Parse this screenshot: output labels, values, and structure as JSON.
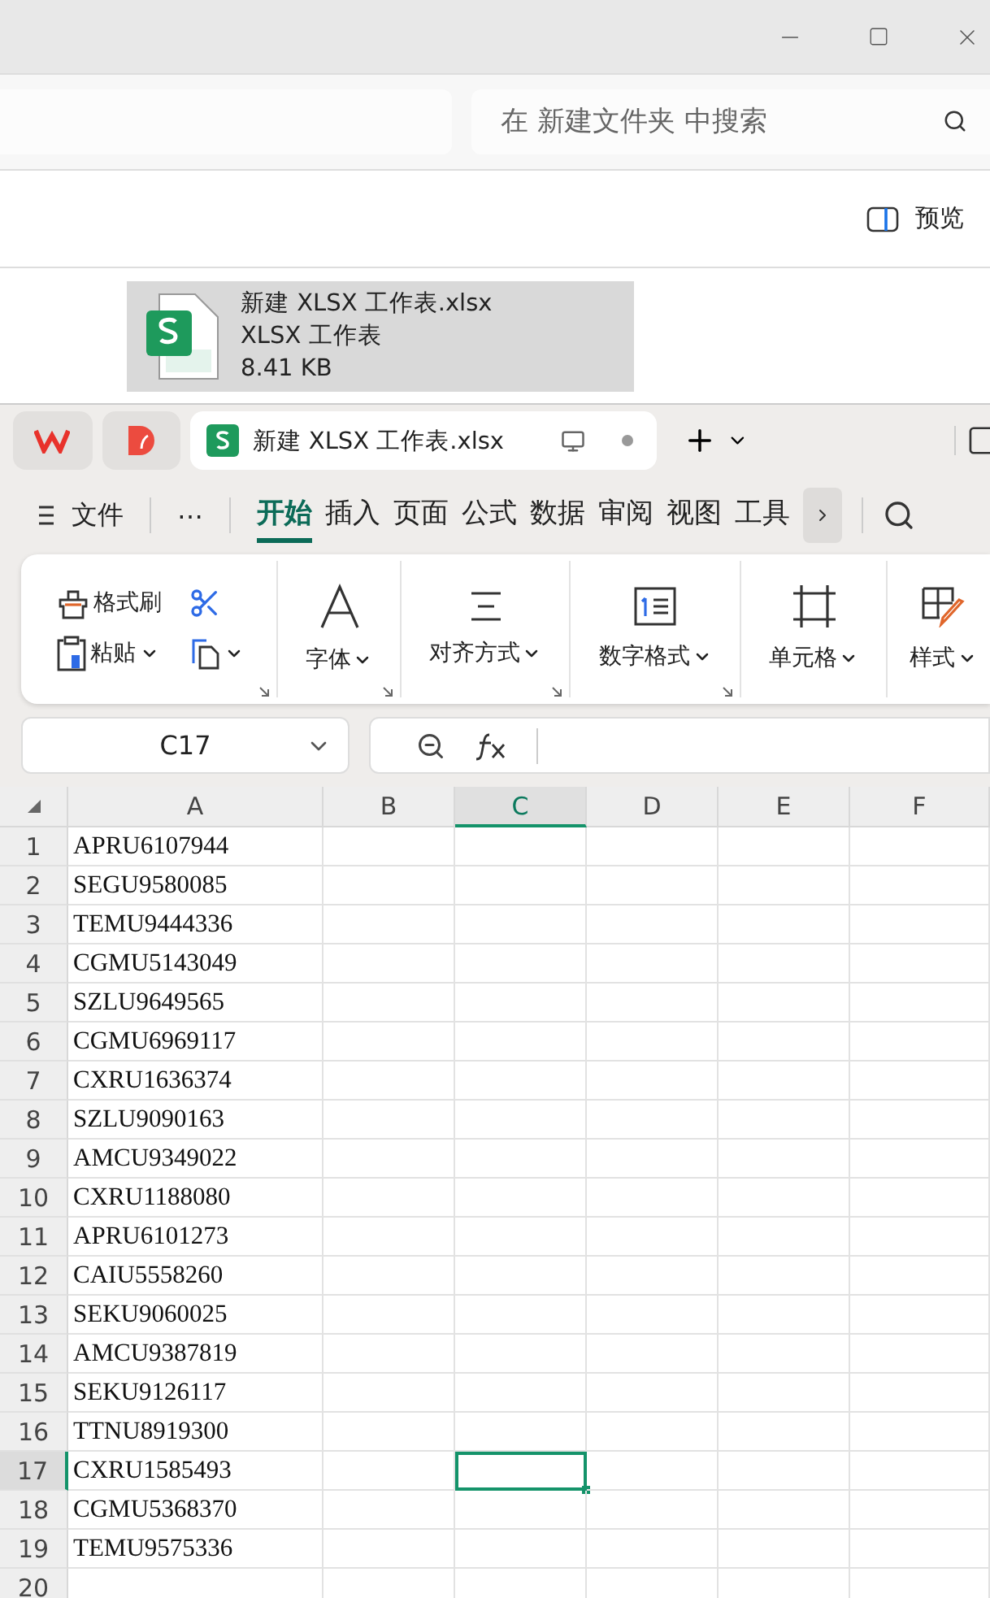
{
  "explorer": {
    "search": {
      "placeholder": "在 新建文件夹 中搜索"
    },
    "preview_button": "预览",
    "file": {
      "name": "新建 XLSX 工作表.xlsx",
      "type": "XLSX 工作表",
      "size": "8.41 KB",
      "selected": true
    }
  },
  "wps": {
    "document_tab": {
      "title": "新建 XLSX 工作表.xlsx",
      "selected": true
    },
    "file_menu": "文件",
    "more_menu": "⋯",
    "menu_tabs": [
      {
        "label": "开始",
        "selected": true
      },
      {
        "label": "插入",
        "selected": false
      },
      {
        "label": "页面",
        "selected": false
      },
      {
        "label": "公式",
        "selected": false
      },
      {
        "label": "数据",
        "selected": false
      },
      {
        "label": "审阅",
        "selected": false
      },
      {
        "label": "视图",
        "selected": false
      },
      {
        "label": "工具",
        "selected": false
      }
    ],
    "clipboard": {
      "format_painter": "格式刷",
      "paste": "粘贴"
    },
    "ribbon_groups": [
      {
        "kind": "font",
        "label": "字体"
      },
      {
        "kind": "align",
        "label": "对齐方式"
      },
      {
        "kind": "number",
        "label": "数字格式"
      },
      {
        "kind": "cell",
        "label": "单元格"
      },
      {
        "kind": "style",
        "label": "样式"
      }
    ],
    "name_box": "C17",
    "columns": [
      {
        "label": "A",
        "selected": false
      },
      {
        "label": "B",
        "selected": false
      },
      {
        "label": "C",
        "selected": true
      },
      {
        "label": "D",
        "selected": false
      },
      {
        "label": "E",
        "selected": false
      },
      {
        "label": "F",
        "selected": false
      }
    ],
    "rows": [
      {
        "number": "1",
        "value": "APRU6107944",
        "selected": false
      },
      {
        "number": "2",
        "value": "SEGU9580085",
        "selected": false
      },
      {
        "number": "3",
        "value": "TEMU9444336",
        "selected": false
      },
      {
        "number": "4",
        "value": "CGMU5143049",
        "selected": false
      },
      {
        "number": "5",
        "value": "SZLU9649565",
        "selected": false
      },
      {
        "number": "6",
        "value": "CGMU6969117",
        "selected": false
      },
      {
        "number": "7",
        "value": "CXRU1636374",
        "selected": false
      },
      {
        "number": "8",
        "value": "SZLU9090163",
        "selected": false
      },
      {
        "number": "9",
        "value": "AMCU9349022",
        "selected": false
      },
      {
        "number": "10",
        "value": "CXRU1188080",
        "selected": false
      },
      {
        "number": "11",
        "value": "APRU6101273",
        "selected": false
      },
      {
        "number": "12",
        "value": "CAIU5558260",
        "selected": false
      },
      {
        "number": "13",
        "value": "SEKU9060025",
        "selected": false
      },
      {
        "number": "14",
        "value": "AMCU9387819",
        "selected": false
      },
      {
        "number": "15",
        "value": "SEKU9126117",
        "selected": false
      },
      {
        "number": "16",
        "value": "TTNU8919300",
        "selected": false
      },
      {
        "number": "17",
        "value": "CXRU1585493",
        "selected": true
      },
      {
        "number": "18",
        "value": "CGMU5368370",
        "selected": false
      },
      {
        "number": "19",
        "value": "TEMU9575336",
        "selected": false
      },
      {
        "number": "20",
        "selected": false
      }
    ]
  }
}
